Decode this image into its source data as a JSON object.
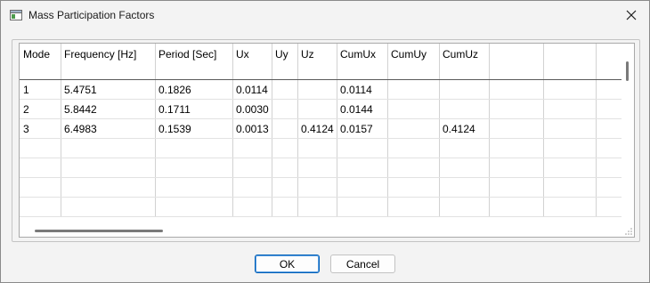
{
  "window": {
    "title": "Mass Participation Factors"
  },
  "grid": {
    "columns": [
      "Mode",
      "Frequency [Hz]",
      "Period [Sec]",
      "Ux",
      "Uy",
      "Uz",
      "CumUx",
      "CumUy",
      "CumUz",
      "",
      ""
    ],
    "rows": [
      [
        "1",
        "5.4751",
        "0.1826",
        "0.0114",
        "",
        "",
        "0.0114",
        "",
        "",
        "",
        ""
      ],
      [
        "2",
        "5.8442",
        "0.1711",
        "0.0030",
        "",
        "",
        "0.0144",
        "",
        "",
        "",
        ""
      ],
      [
        "3",
        "6.4983",
        "0.1539",
        "0.0013",
        "",
        "0.4124",
        "0.0157",
        "",
        "0.4124",
        "",
        ""
      ],
      [
        "",
        "",
        "",
        "",
        "",
        "",
        "",
        "",
        "",
        "",
        ""
      ],
      [
        "",
        "",
        "",
        "",
        "",
        "",
        "",
        "",
        "",
        "",
        ""
      ],
      [
        "",
        "",
        "",
        "",
        "",
        "",
        "",
        "",
        "",
        "",
        ""
      ],
      [
        "",
        "",
        "",
        "",
        "",
        "",
        "",
        "",
        "",
        "",
        ""
      ]
    ]
  },
  "buttons": {
    "ok": "OK",
    "cancel": "Cancel"
  },
  "icons": {
    "app": "window-icon",
    "close": "close-icon",
    "grip": "resize-grip-icon"
  },
  "colors": {
    "default_button_border": "#005fb8",
    "header_rule": "#5a5a5a"
  }
}
